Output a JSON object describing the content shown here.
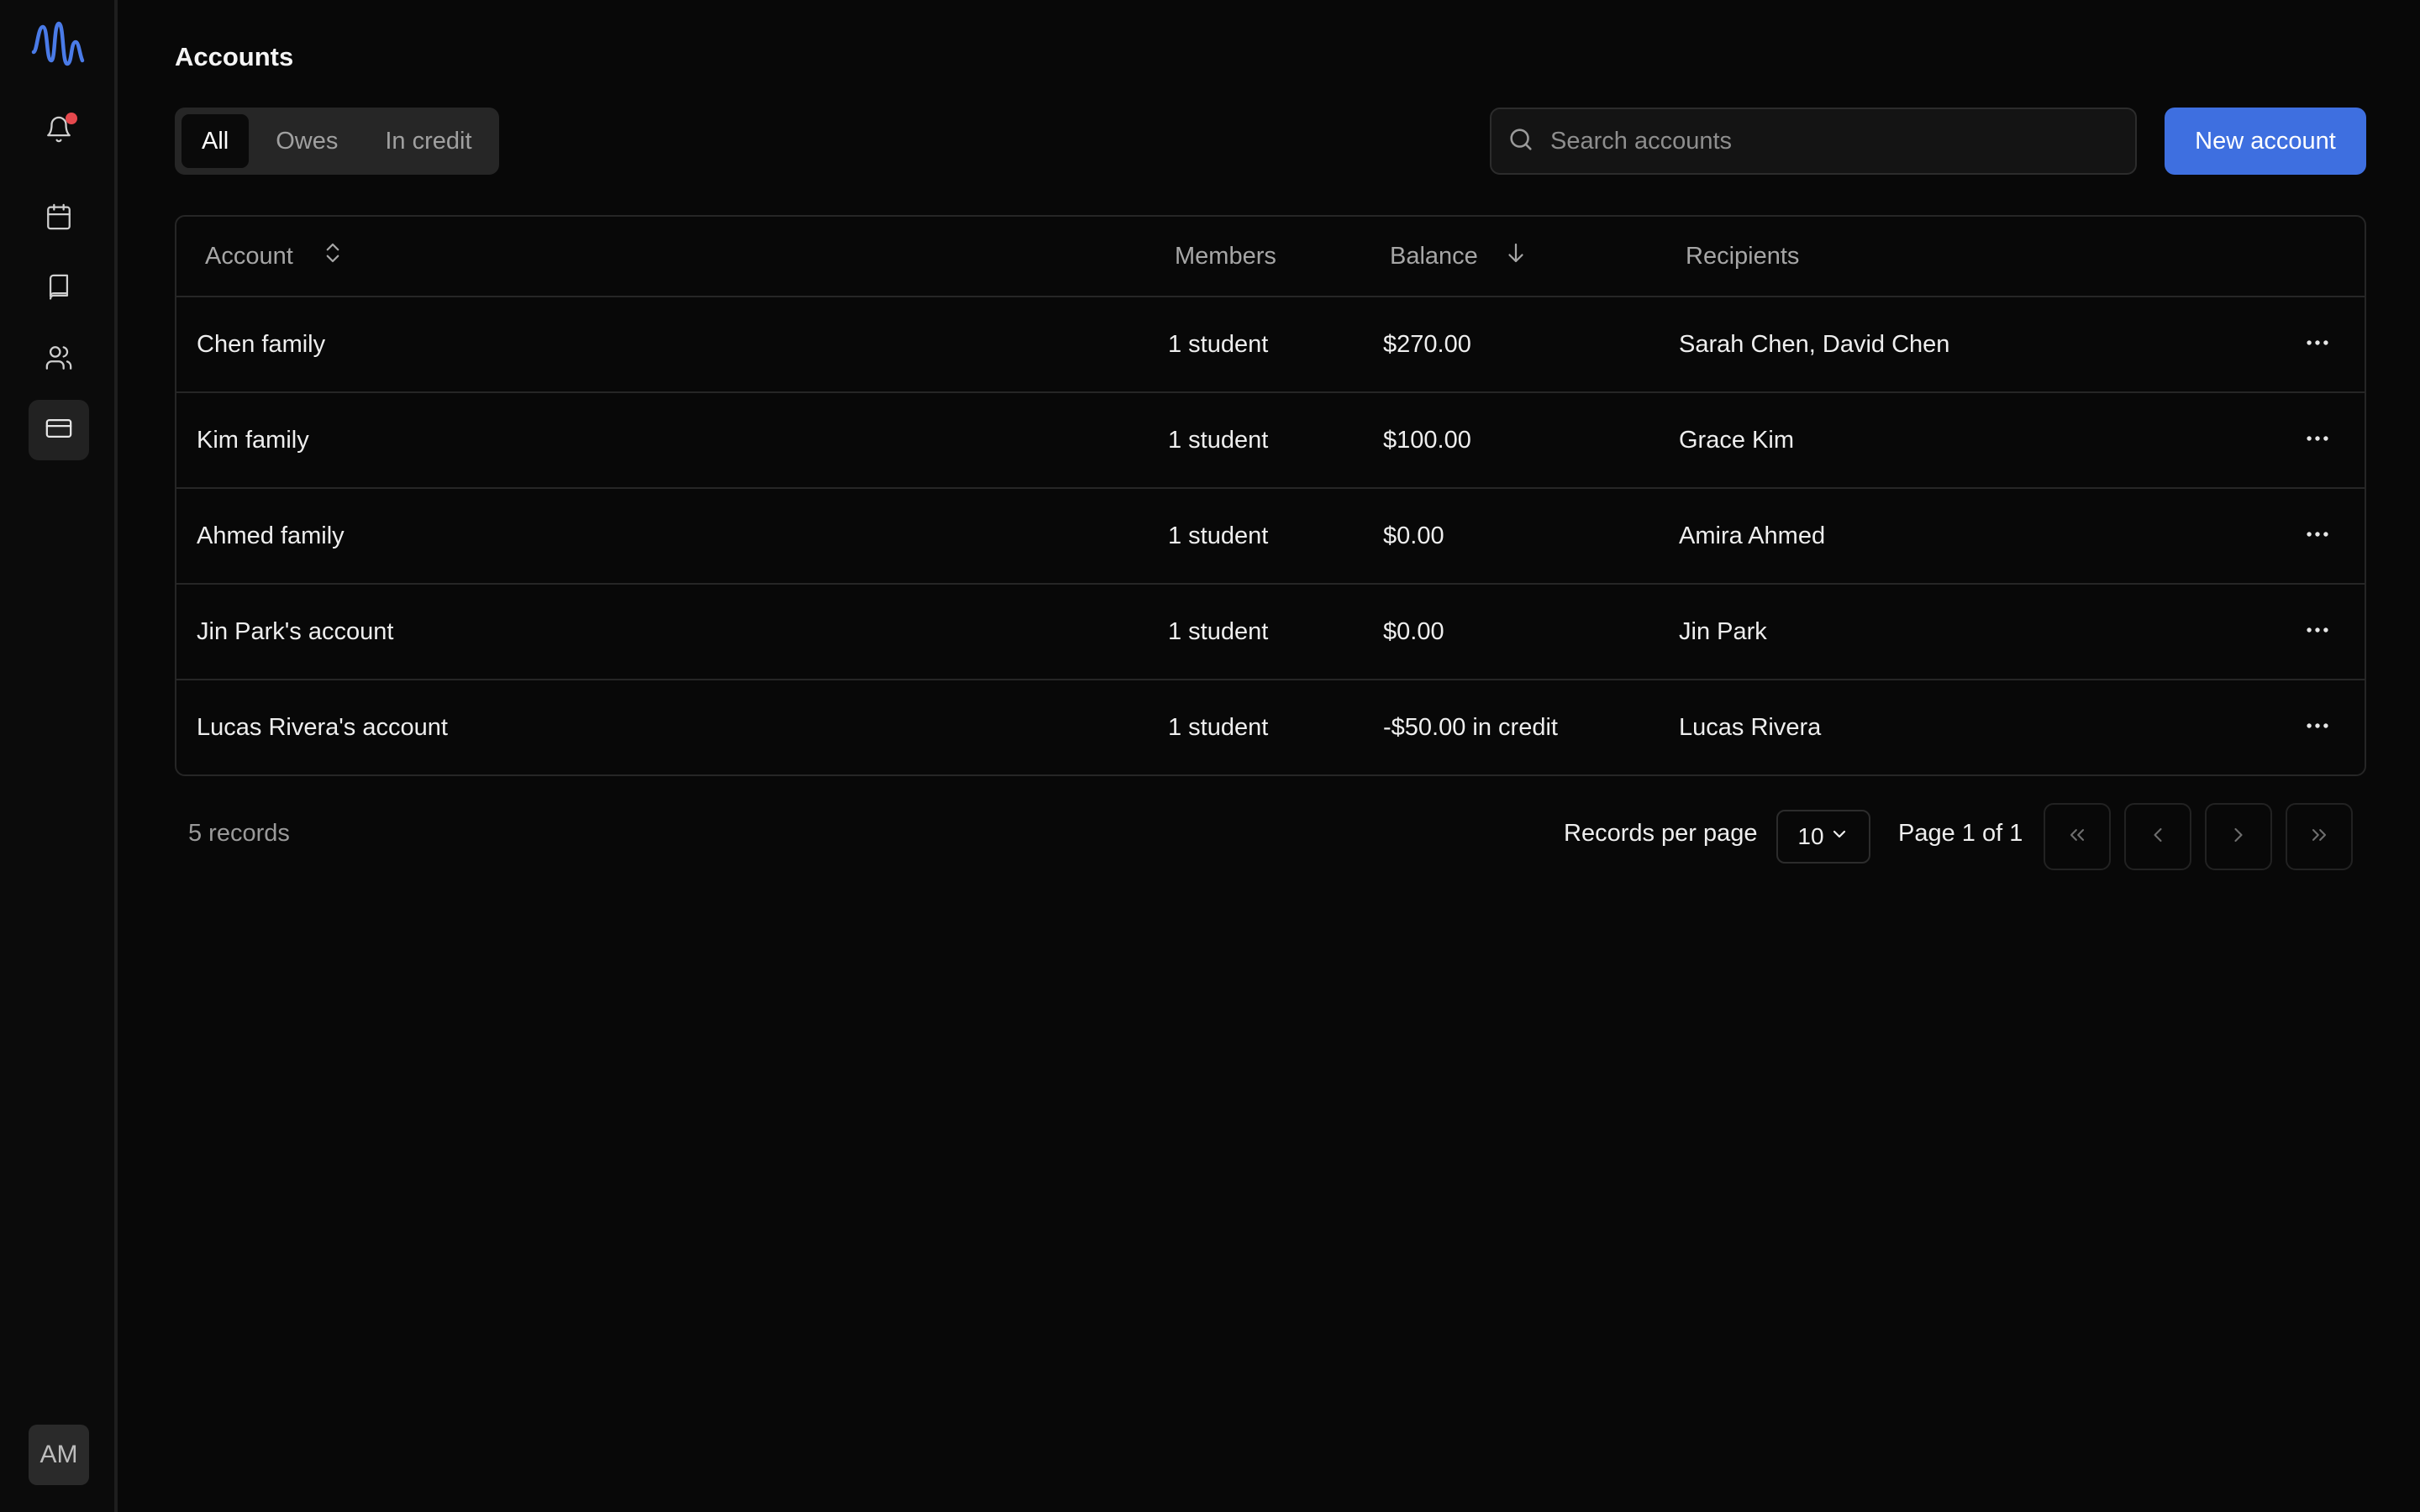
{
  "sidebar": {
    "logo": "wave-logo-icon",
    "items": [
      {
        "name": "bell-icon",
        "has_notification": true
      },
      {
        "name": "calendar-icon"
      },
      {
        "name": "book-icon"
      },
      {
        "name": "users-icon"
      },
      {
        "name": "credit-card-icon",
        "active": true
      }
    ],
    "avatar_initials": "AM"
  },
  "header": {
    "title": "Accounts"
  },
  "filters": {
    "all": "All",
    "owes": "Owes",
    "in_credit": "In credit",
    "selected": "All"
  },
  "search": {
    "placeholder": "Search accounts",
    "value": ""
  },
  "toolbar": {
    "new_account_label": "New account"
  },
  "table": {
    "columns": {
      "account": "Account",
      "members": "Members",
      "balance": "Balance",
      "recipients": "Recipients"
    },
    "rows": [
      {
        "account": "Chen family",
        "members": "1 student",
        "balance": "$270.00",
        "recipients": "Sarah Chen, David Chen"
      },
      {
        "account": "Kim family",
        "members": "1 student",
        "balance": "$100.00",
        "recipients": "Grace Kim"
      },
      {
        "account": "Ahmed family",
        "members": "1 student",
        "balance": "$0.00",
        "recipients": "Amira Ahmed"
      },
      {
        "account": "Jin Park's account",
        "members": "1 student",
        "balance": "$0.00",
        "recipients": "Jin Park"
      },
      {
        "account": "Lucas Rivera's account",
        "members": "1 student",
        "balance": "-$50.00 in credit",
        "recipients": "Lucas Rivera"
      }
    ]
  },
  "footer": {
    "records": "5 records",
    "rows_per_page_label": "Records per page",
    "rows_per_page_value": "10",
    "page_info": "Page 1 of 1"
  },
  "colors": {
    "background": "#080808",
    "accent": "#3e6fe0",
    "logo": "#4a7be8",
    "notification": "#e5484d",
    "border": "#262626"
  }
}
